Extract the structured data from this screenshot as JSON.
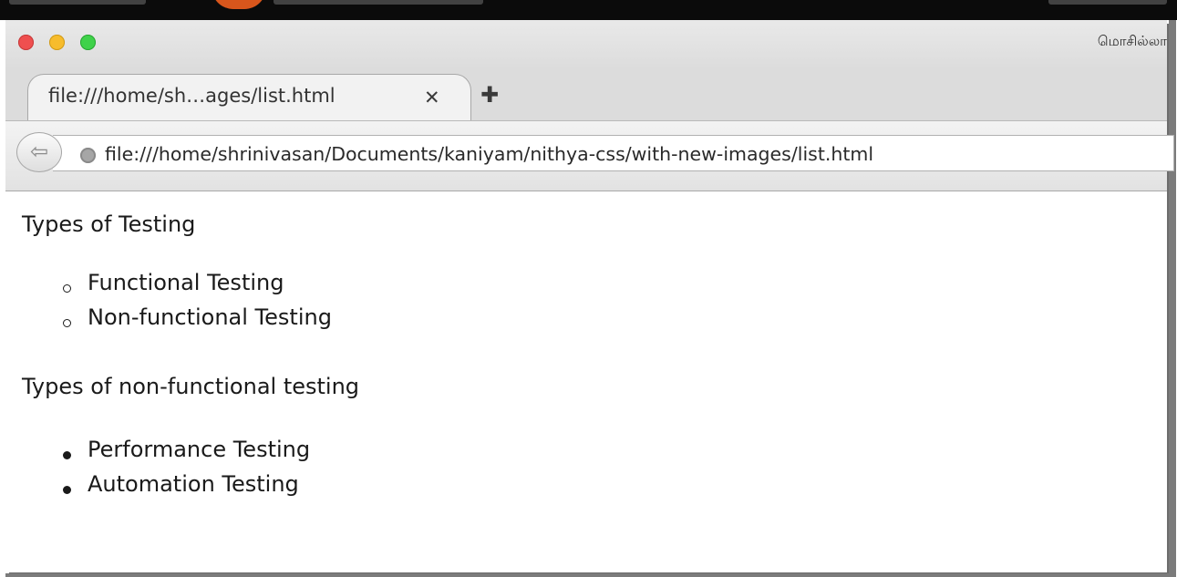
{
  "window": {
    "title": "மொசில்லா"
  },
  "tabs": [
    {
      "label": "file:///home/sh…ages/list.html",
      "close_icon": "close-icon"
    }
  ],
  "new_tab_icon": "plus-icon",
  "navbar": {
    "back_icon": "back-arrow-icon",
    "url": "file:///home/shrinivasan/Documents/kaniyam/nithya-css/with-new-images/list.html"
  },
  "page": {
    "section1": {
      "heading": "Types of Testing",
      "items": [
        "Functional Testing",
        "Non-functional Testing"
      ]
    },
    "section2": {
      "heading": "Types of non-functional testing",
      "items": [
        "Performance Testing",
        "Automation Testing"
      ]
    }
  }
}
